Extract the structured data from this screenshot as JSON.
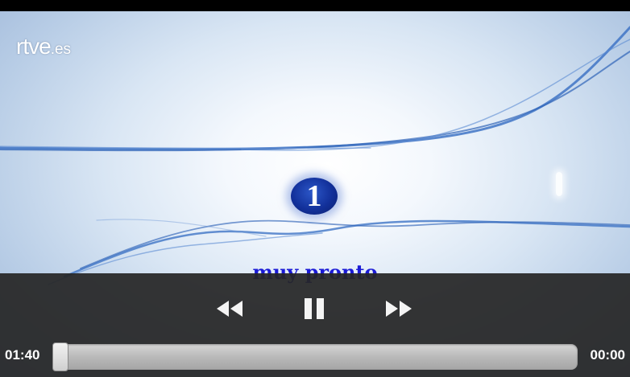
{
  "video": {
    "watermark_main": "rtve",
    "watermark_suffix": ".es",
    "channel_number": "1",
    "tagline": "muy pronto"
  },
  "controls": {
    "rewind_icon": "rewind-icon",
    "pause_icon": "pause-icon",
    "fast_forward_icon": "fast-forward-icon",
    "elapsed_time": "01:40",
    "total_time": "00:00",
    "seek_progress_fraction": 0.0
  },
  "colors": {
    "tagline": "#1b1bd6",
    "controls_bar": "#262626",
    "seek_track": "#b9b9b9",
    "channel_badge": "#12309a"
  }
}
